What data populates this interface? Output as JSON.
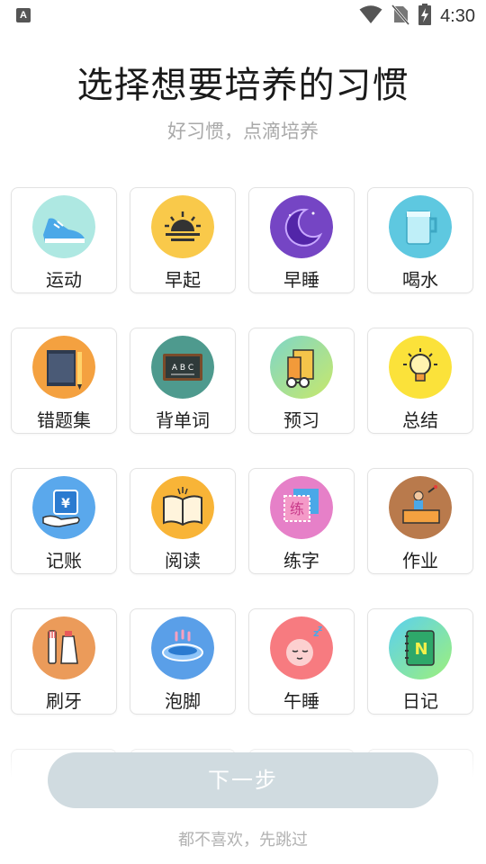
{
  "status_bar": {
    "notification_icon": "A",
    "time": "4:30",
    "icons": [
      "wifi-icon",
      "no-sim-icon",
      "battery-charging-icon"
    ]
  },
  "header": {
    "title": "选择想要培养的习惯",
    "subtitle": "好习惯，点滴培养"
  },
  "habits": [
    {
      "label": "运动",
      "icon": "sneaker-icon",
      "color": "#a8e6e0"
    },
    {
      "label": "早起",
      "icon": "sunrise-icon",
      "color": "#f9c94a"
    },
    {
      "label": "早睡",
      "icon": "moon-icon",
      "color": "#7b45c9"
    },
    {
      "label": "喝水",
      "icon": "water-cup-icon",
      "color": "#5ec8e0"
    },
    {
      "label": "错题集",
      "icon": "notebook-icon",
      "color": "#f4a140"
    },
    {
      "label": "背单词",
      "icon": "blackboard-icon",
      "color": "#4e9a8e"
    },
    {
      "label": "预习",
      "icon": "books-glasses-icon",
      "color": "#a8d86e"
    },
    {
      "label": "总结",
      "icon": "lightbulb-icon",
      "color": "#fbe23a"
    },
    {
      "label": "记账",
      "icon": "wallet-hand-icon",
      "color": "#5aa8ec"
    },
    {
      "label": "阅读",
      "icon": "open-book-icon",
      "color": "#f8b437"
    },
    {
      "label": "练字",
      "icon": "calligraphy-icon",
      "color": "#e680c8"
    },
    {
      "label": "作业",
      "icon": "teacher-desk-icon",
      "color": "#b97a4c"
    },
    {
      "label": "刷牙",
      "icon": "toothbrush-icon",
      "color": "#eb9b5a"
    },
    {
      "label": "泡脚",
      "icon": "foot-bath-icon",
      "color": "#5a9fe8"
    },
    {
      "label": "午睡",
      "icon": "sleeping-face-icon",
      "color": "#f77b80"
    },
    {
      "label": "日记",
      "icon": "diary-icon",
      "color": "#7ee08a"
    }
  ],
  "footer": {
    "next_label": "下一步",
    "skip_label": "都不喜欢，先跳过"
  }
}
